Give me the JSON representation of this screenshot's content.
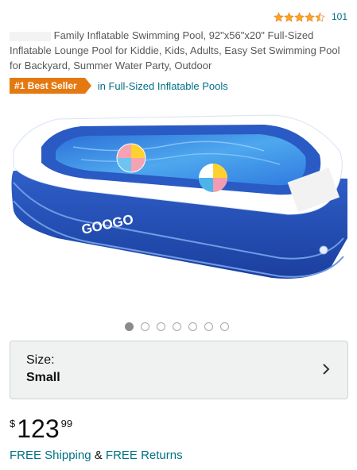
{
  "rating": {
    "stars": 4.5,
    "count": "101"
  },
  "product": {
    "title": "Family Inflatable Swimming Pool, 92\"x56\"x20\" Full-Sized Inflatable Lounge Pool for Kiddie, Kids, Adults, Easy Set Swimming Pool for Backyard, Summer Water Party, Outdoor",
    "brand_logo": "GOOGO"
  },
  "badge": {
    "label": "#1 Best Seller",
    "category": "in Full-Sized Inflatable Pools"
  },
  "gallery": {
    "dot_count": 7,
    "active_index": 0
  },
  "size": {
    "label": "Size:",
    "value": "Small"
  },
  "price": {
    "currency": "$",
    "whole": "123",
    "fraction": "99"
  },
  "shipping": {
    "free_shipping": "FREE Shipping",
    "ampersand": "&",
    "free_returns": "FREE Returns"
  },
  "colors": {
    "link": "#007185",
    "badge": "#e47911",
    "star": "#ffa41c"
  }
}
